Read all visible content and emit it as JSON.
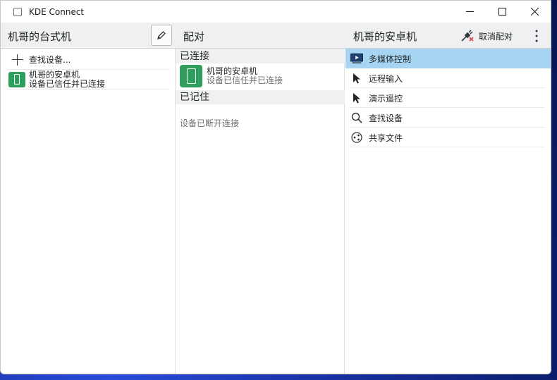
{
  "window": {
    "title": "KDE Connect"
  },
  "header": {
    "local_device": "机哥的台式机",
    "pair_title": "配对",
    "remote_device": "机哥的安卓机",
    "unpair_label": "取消配对"
  },
  "device_list": {
    "find_devices": "查找设备...",
    "devices": [
      {
        "name": "机哥的安卓机",
        "status": "设备已信任并已连接"
      }
    ]
  },
  "pairing": {
    "connected_header": "已连接",
    "connected": [
      {
        "name": "机哥的安卓机",
        "status": "设备已信任并已连接"
      }
    ],
    "remembered_header": "已记住",
    "remembered_status": "设备已断开连接"
  },
  "plugins": {
    "items": [
      {
        "label": "多媒体控制",
        "icon": "media-player-icon",
        "selected": true
      },
      {
        "label": "远程输入",
        "icon": "pointer-icon"
      },
      {
        "label": "演示遥控",
        "icon": "presenter-pointer-icon"
      },
      {
        "label": "查找设备",
        "icon": "search-icon"
      },
      {
        "label": "共享文件",
        "icon": "share-icon"
      }
    ]
  },
  "colors": {
    "selection": "#a6d4f1",
    "device_icon": "#2f9e5c",
    "header_bg": "#eff0f1"
  }
}
